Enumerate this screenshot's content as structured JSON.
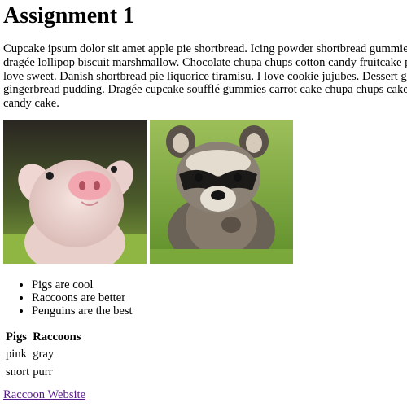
{
  "page": {
    "title": "Assignment 1",
    "intro_text": "Cupcake ipsum dolor sit amet apple pie shortbread. Icing powder shortbread gummies candy bar. Marzipan dragée lollipop biscuit marshmallow. Chocolate chupa chups cotton candy fruitcake pastry cupcake dessert I love sweet. Danish shortbread pie liquorice tiramisu. I love cookie jujubes. Dessert gingerbread oat cake gingerbread pudding. Dragée cupcake soufflé gummies carrot cake chupa chups cake sesame snaps cotton candy cake."
  },
  "images": [
    {
      "subject": "piglet"
    },
    {
      "subject": "raccoon"
    }
  ],
  "list": {
    "items": [
      "Pigs are cool",
      "Raccoons are better",
      "Penguins are the best"
    ]
  },
  "table": {
    "headers": [
      "Pigs",
      "Raccoons"
    ],
    "rows": [
      [
        "pink",
        "gray"
      ],
      [
        "snort",
        "purr"
      ]
    ]
  },
  "link": {
    "text": "Raccoon Website",
    "color": "#551a8b"
  }
}
